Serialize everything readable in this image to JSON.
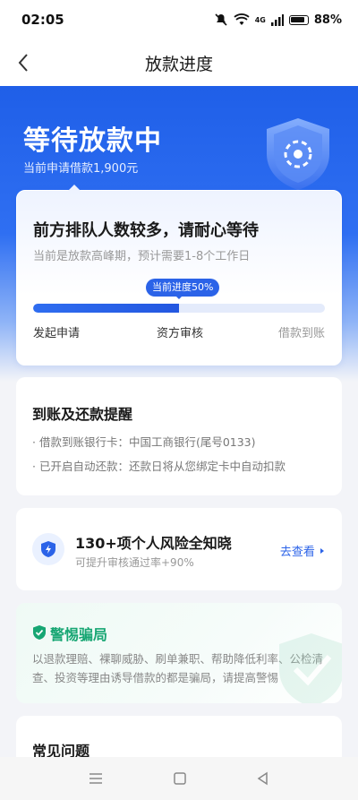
{
  "status_bar": {
    "time": "02:05",
    "network": "4G",
    "battery": "88%"
  },
  "nav": {
    "title": "放款进度"
  },
  "hero": {
    "title": "等待放款中",
    "subtitle": "当前申请借款1,900元"
  },
  "progress": {
    "title": "前方排队人数较多，请耐心等待",
    "desc": "当前是放款高峰期，预计需要1-8个工作日",
    "chip": "当前进度50%",
    "percent": 50,
    "steps": [
      "发起申请",
      "资方审核",
      "借款到账"
    ]
  },
  "reminder": {
    "title": "到账及还款提醒",
    "lines": [
      "· 借款到账银行卡：中国工商银行(尾号0133)",
      "· 已开启自动还款：还款日将从您绑定卡中自动扣款"
    ]
  },
  "risk": {
    "title": "130+项个人风险全知晓",
    "subtitle": "可提升审核通过率+90%",
    "link": "去查看"
  },
  "fraud": {
    "title": "警惕骗局",
    "text": "以退款理赔、裸聊威胁、刷单兼职、帮助降低利率、公检清查、投资等理由诱导借款的都是骗局，请提高警惕"
  },
  "faq": {
    "title": "常见问题"
  },
  "colors": {
    "accent": "#2b63e8",
    "hero": "#1f5fe8",
    "fraud_green": "#17a673"
  }
}
